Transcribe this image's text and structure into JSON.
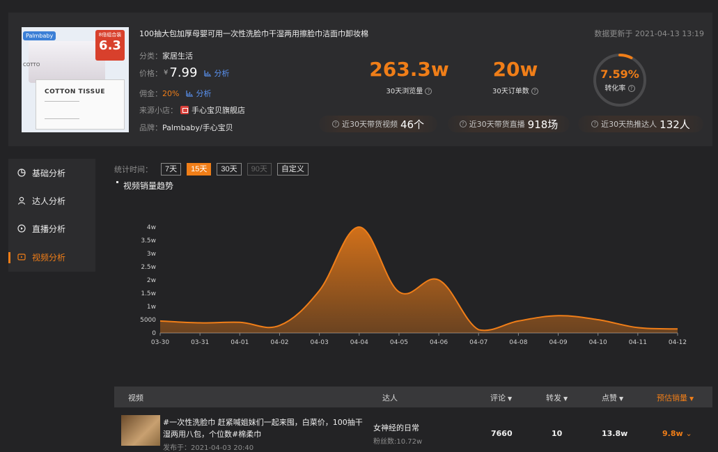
{
  "product": {
    "title": "100抽大包加厚母婴可用一次性洗脸巾干湿两用擦脸巾洁面巾卸妆棉",
    "updated": "数据更新于 2021-04-13 13:19",
    "category_label": "分类：",
    "category": "家居生活",
    "price_label": "价格：",
    "price_currency": "¥",
    "price": "7.99",
    "commission_label": "佣金：",
    "commission": "20%",
    "analysis_link": "分析",
    "shop_label": "来源小店：",
    "shop": "手心宝贝旗舰店",
    "brand_label": "品牌：",
    "brand": "Palmbaby/手心宝贝",
    "thumb": {
      "brand_tag": "Palmbaby",
      "price_tag_top": "8倍组合装",
      "price_tag_big": "6.3",
      "pack_text": "COTTON TISSUE",
      "side_text": "COTTO"
    }
  },
  "stats": {
    "views": {
      "value": "263.3w",
      "label": "30天浏览量"
    },
    "orders": {
      "value": "20w",
      "label": "30天订单数"
    },
    "conversion": {
      "value": "7.59%",
      "label": "转化率",
      "fraction": 0.0759
    }
  },
  "pills": [
    {
      "label": "近30天带货视频",
      "value": "46个"
    },
    {
      "label": "近30天带货直播",
      "value": "918场"
    },
    {
      "label": "近30天热推达人",
      "value": "132人"
    }
  ],
  "sidebar": [
    {
      "label": "基础分析",
      "icon": "chart-circle-icon",
      "active": false
    },
    {
      "label": "达人分析",
      "icon": "person-icon",
      "active": false
    },
    {
      "label": "直播分析",
      "icon": "play-circle-icon",
      "active": false
    },
    {
      "label": "视频分析",
      "icon": "video-icon",
      "active": true
    }
  ],
  "filter": {
    "label": "统计时间：",
    "options": [
      "7天",
      "15天",
      "30天",
      "90天",
      "自定义"
    ],
    "selected": "15天",
    "disabled": "90天"
  },
  "chart_title": "视频销量趋势",
  "chart_data": {
    "type": "area",
    "x": [
      "03-30",
      "03-31",
      "04-01",
      "04-02",
      "04-03",
      "04-04",
      "04-05",
      "04-06",
      "04-07",
      "04-08",
      "04-09",
      "04-10",
      "04-11",
      "04-12"
    ],
    "values": [
      4500,
      3800,
      4000,
      2800,
      16000,
      40000,
      15500,
      20000,
      1200,
      4500,
      6500,
      5000,
      2000,
      1500
    ],
    "ylabel_ticks": [
      "0",
      "5000",
      "1w",
      "1.5w",
      "2w",
      "2.5w",
      "3w",
      "3.5w",
      "4w"
    ],
    "ylim": [
      0,
      40000
    ],
    "color": "#f07e18"
  },
  "table": {
    "headers": {
      "video": "视频",
      "kol": "达人",
      "comments": "评论",
      "shares": "转发",
      "likes": "点赞",
      "sales": "预估销量"
    },
    "rows": [
      {
        "title": "#一次性洗脸巾 赶紧喊姐妹们一起来囤，白菜价，100抽干湿两用八包，个位数#棉柔巾",
        "date": "发布于：2021-04-03 20:40",
        "kol": "女神经的日常",
        "fans": "粉丝数:10.72w",
        "comments": "7660",
        "shares": "10",
        "likes": "13.8w",
        "sales": "9.8w"
      }
    ]
  }
}
